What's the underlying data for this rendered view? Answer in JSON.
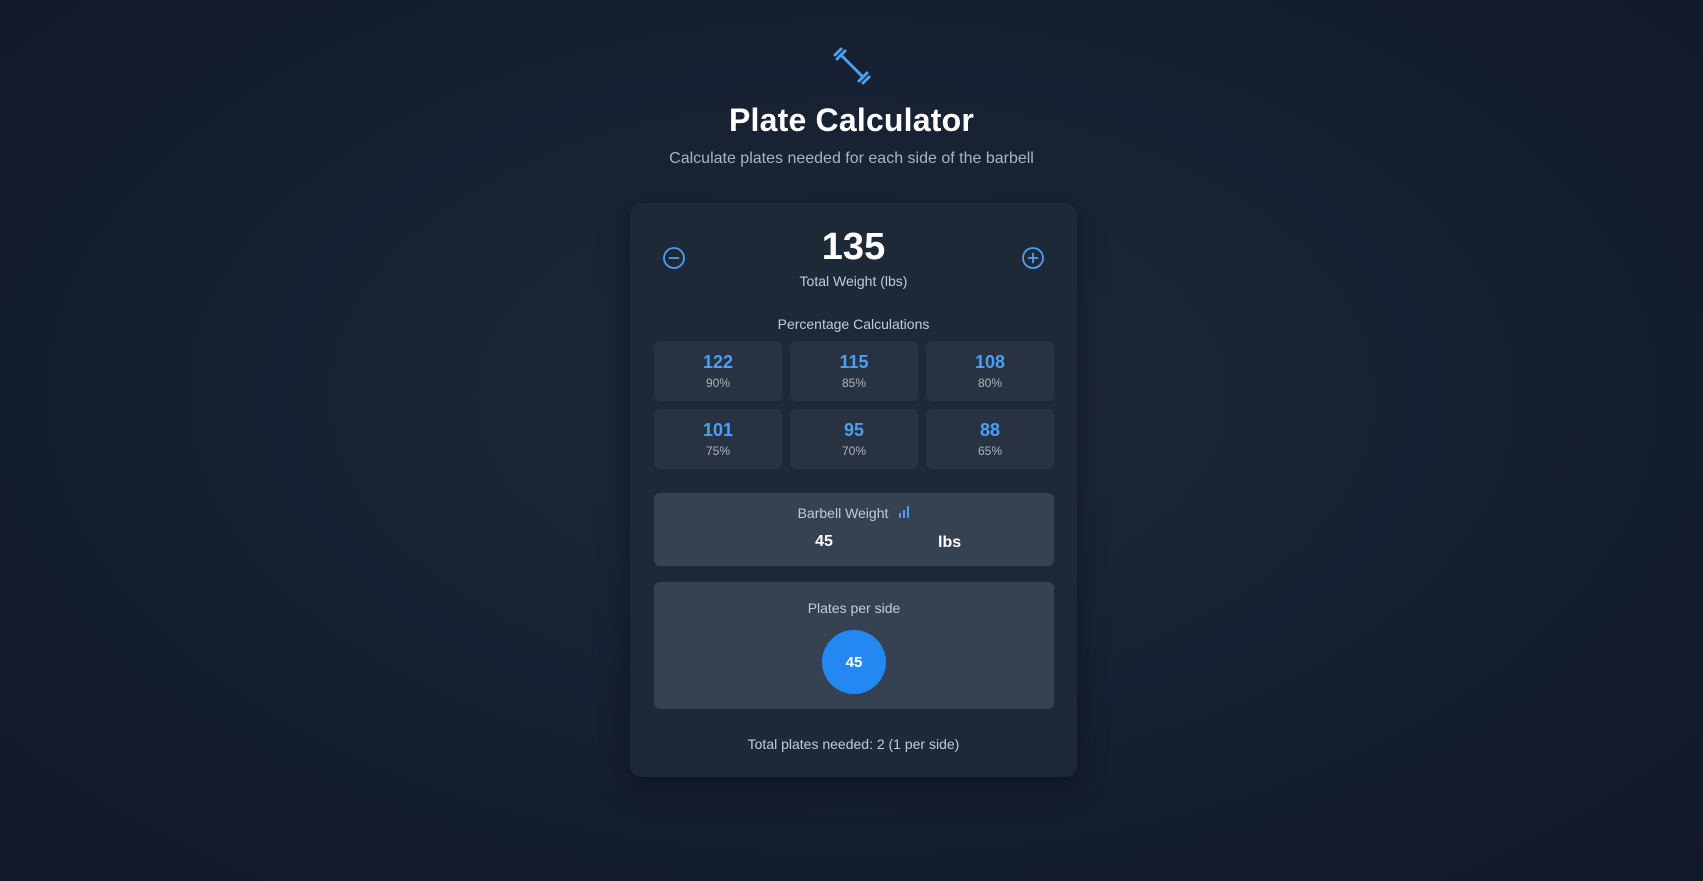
{
  "header": {
    "icon": "dumbbell-icon",
    "title": "Plate Calculator",
    "subtitle": "Calculate plates needed for each side of the barbell"
  },
  "weight": {
    "value": "135",
    "label": "Total Weight (lbs)",
    "decrease_icon": "minus-circle-icon",
    "increase_icon": "plus-circle-icon"
  },
  "percentages": {
    "title": "Percentage Calculations",
    "items": [
      {
        "value": "122",
        "label": "90%"
      },
      {
        "value": "115",
        "label": "85%"
      },
      {
        "value": "108",
        "label": "80%"
      },
      {
        "value": "101",
        "label": "75%"
      },
      {
        "value": "95",
        "label": "70%"
      },
      {
        "value": "88",
        "label": "65%"
      }
    ]
  },
  "barbell": {
    "label": "Barbell Weight",
    "icon": "bar-chart-icon",
    "value": "45",
    "unit": "lbs"
  },
  "plates": {
    "title": "Plates per side",
    "items": [
      "45"
    ],
    "total_text": "Total plates needed: 2 (1 per side)"
  },
  "colors": {
    "accent": "#4d9ef6",
    "plate": "#2388f2",
    "card": "#1e2938"
  }
}
